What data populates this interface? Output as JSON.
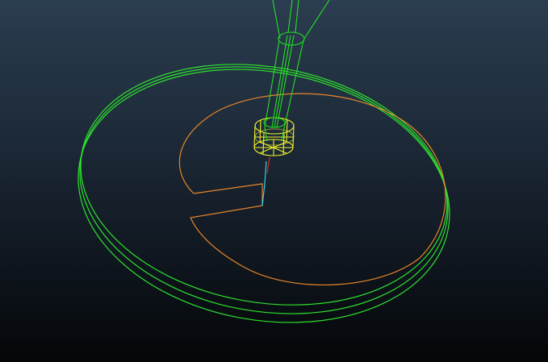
{
  "viewport": {
    "background_top": "#2b3d50",
    "background_bottom": "#040608"
  },
  "colors": {
    "disc_outline": "#2ee22e",
    "tool_holder": "#22e022",
    "cutter": "#f0f02a",
    "toolpath": "#e8862a",
    "lead_in": "#2fd6e6",
    "plunge_move": "#e02424"
  },
  "icons": {
    "disc": "wireframe-disc-icon",
    "tool": "wireframe-tool-icon",
    "path": "toolpath-icon"
  }
}
